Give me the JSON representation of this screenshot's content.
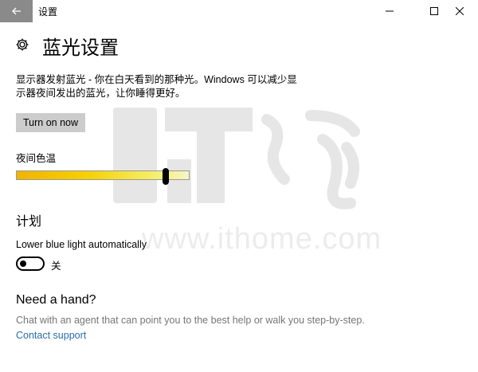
{
  "window": {
    "title": "设置",
    "back_icon": "arrow-left-icon",
    "minimize_icon": "minimize-icon",
    "maximize_icon": "maximize-icon",
    "close_icon": "close-icon"
  },
  "header": {
    "icon": "gear-icon",
    "title": "蓝光设置"
  },
  "description": "显示器发射蓝光 - 你在白天看到的那种光。Windows 可以减少显示器夜间发出的蓝光，让你睡得更好。",
  "turn_on_button": "Turn on now",
  "color_temp": {
    "label": "夜间色温",
    "level": 0.87
  },
  "schedule": {
    "title": "计划",
    "auto_label": "Lower blue light automatically",
    "toggle_state": "关",
    "toggle_on": false
  },
  "help": {
    "title": "Need a hand?",
    "text": "Chat with an agent that can point you to the best help or walk you step-by-step.",
    "link": "Contact support"
  },
  "watermark": {
    "text": "www.ithome.com"
  },
  "colors": {
    "titlebar_back": "#8a8a8a",
    "button_bg": "#cccccc",
    "link": "#2a6ea8",
    "muted_text": "#767676"
  }
}
